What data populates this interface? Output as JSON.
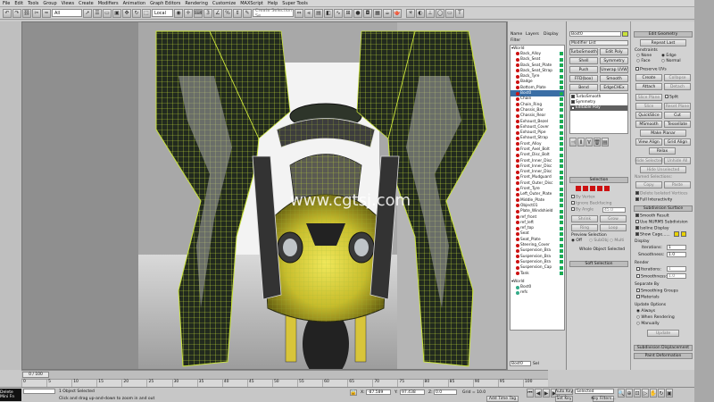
{
  "menu": [
    "File",
    "Edit",
    "Tools",
    "Group",
    "Views",
    "Create",
    "Modifiers",
    "Animation",
    "Graph Editors",
    "Rendering",
    "Customize",
    "MAXScript",
    "Help",
    "Super Tools"
  ],
  "toolbar": {
    "filter_value": "All",
    "ref_coord_value": "Local",
    "selection_set_placeholder": "Create Selection Se"
  },
  "watermark": "www.cgtsj.com",
  "scene_explorer": {
    "tabs": [
      "Name",
      "Layers",
      "Display"
    ],
    "filter_label": "Filter",
    "group_label": "World",
    "items": [
      "Back_Alloy",
      "Back_Seat",
      "Back_Seat_Plate",
      "Back_Seat_Strap",
      "Back_Tyre",
      "Badge",
      "Bottom_Plate",
      "Bost0",
      "Chain",
      "Chain_Ring",
      "Chassis_Bar",
      "Chassis_Rear",
      "Exhaust_Bezel",
      "Exhaust_Cover",
      "Exhaust_Pipe",
      "Exhaust_Strap",
      "Front_Alloy",
      "Front_Axel_Bolt",
      "Front_Disc_Bolt",
      "Front_Inner_Disc",
      "Front_Inner_Disc",
      "Front_Inner_Disc",
      "Front_Mudguard",
      "Front_Outer_Disc",
      "Front_Tyre",
      "Left_Outer_Plate",
      "Middle_Plate",
      "Object01",
      "Plate_Windshield",
      "ref_front",
      "ref_left",
      "ref_top",
      "Seat",
      "Seat_Plate",
      "Steering_Cover",
      "Suspension_Bra",
      "Suspension_Bra",
      "Suspension_Bra",
      "Suspension_Cap",
      "Tank"
    ],
    "world2_label": "World",
    "world2_items": [
      "Bost0",
      "refs"
    ],
    "footer_field": "Bost0",
    "footer_label": "Sel"
  },
  "modify_panel": {
    "object_name": "Bost0",
    "modifier_list": "Modifier List",
    "buttons": [
      [
        "TurboSmooth",
        "Edit Poly"
      ],
      [
        "Shell",
        "Symmetry"
      ],
      [
        "Push",
        "Unwrap UVW"
      ],
      [
        "FFD(box)",
        "Smooth"
      ],
      [
        "Bend",
        "EdgeCHEx"
      ]
    ],
    "stack": [
      "TurboSmooth",
      "Symmetry",
      "Editable Poly"
    ],
    "selection_rollout": "Selection",
    "by_vertex": "By Vertex",
    "ignore_backfacing": "Ignore Backfacing",
    "by_angle": "By Angle",
    "angle_value": "45.0",
    "shrink": "Shrink",
    "grow": "Grow",
    "ring": "Ring",
    "loop": "Loop",
    "preview_selection": "Preview Selection",
    "preview_opts": [
      "Off",
      "SubObj",
      "Multi"
    ],
    "whole_object_selected": "Whole Object Selected",
    "soft_selection": "Soft Selection"
  },
  "edit_panel": {
    "edit_geometry": "Edit Geometry",
    "repeat_last": "Repeat Last",
    "constraints": "Constraints",
    "constraint_opts": [
      "None",
      "Edge",
      "Face",
      "Normal"
    ],
    "preserve_uvs": "Preserve UVs",
    "create": "Create",
    "collapse": "Collapse",
    "attach": "Attach",
    "detach": "Detach",
    "slice_plane": "Slice Plane",
    "split": "Split",
    "slice": "Slice",
    "reset_plane": "Reset Plane",
    "quickslice": "QuickSlice",
    "cut": "Cut",
    "msmooth": "MSmooth",
    "tessellate": "Tessellate",
    "make_planar": "Make Planar",
    "view_align": "View Align",
    "grid_align": "Grid Align",
    "relax": "Relax",
    "hide_selected": "Hide Selected",
    "unhide_all": "Unhide All",
    "hide_unselected": "Hide Unselected",
    "named_selections": "Named Selections:",
    "copy": "Copy",
    "paste": "Paste",
    "delete_isolated": "Delete Isolated Vertices",
    "full_interactivity": "Full Interactivity",
    "subdivision_surface": "Subdivision Surface",
    "smooth_result": "Smooth Result",
    "use_nurms": "Use NURMS Subdivision",
    "isoline_display": "Isoline Display",
    "show_cage": "Show Cage......",
    "display": "Display",
    "iterations_label": "Iterations:",
    "iterations_value": "1",
    "smoothness_label": "Smoothness:",
    "smoothness_value": "1.0",
    "render": "Render",
    "separate_by": "Separate By",
    "smoothing_groups": "Smoothing Groups",
    "materials": "Materials",
    "update_options": "Update Options",
    "update_opts": [
      "Always",
      "When Rendering",
      "Manually"
    ],
    "update_button": "Update",
    "subdivision_displacement": "Subdivision Displacement",
    "paint_deformation": "Paint Deformation"
  },
  "timeline": {
    "frame_display": "0 / 100",
    "ticks": [
      "0",
      "5",
      "10",
      "15",
      "20",
      "25",
      "30",
      "35",
      "40",
      "45",
      "50",
      "55",
      "60",
      "65",
      "70",
      "75",
      "80",
      "85",
      "90",
      "95",
      "100"
    ]
  },
  "status": {
    "maxscript_label": "Delete Mini Fn",
    "selected_text": "1 Object Selected",
    "prompt_text": "Click and drag up-and-down to zoom in and out",
    "coord_x_label": "X:",
    "coord_x": "-87.589",
    "coord_y_label": "Y:",
    "coord_y": "97.438",
    "coord_z_label": "Z:",
    "coord_z": "0.0",
    "grid_label": "Grid = 10.0",
    "autokey": "Auto Key",
    "selected_dropdown": "Selected",
    "setkey": "Set Key",
    "key_filters": "Key Filters...",
    "add_time_tag": "Add Time Tag"
  },
  "colors": {
    "wire": "#c9e23a",
    "body": "#d7cf3c",
    "frame": "#222a1e",
    "viewport_bg": "#a9a9a9",
    "active_stack": "#606060"
  }
}
